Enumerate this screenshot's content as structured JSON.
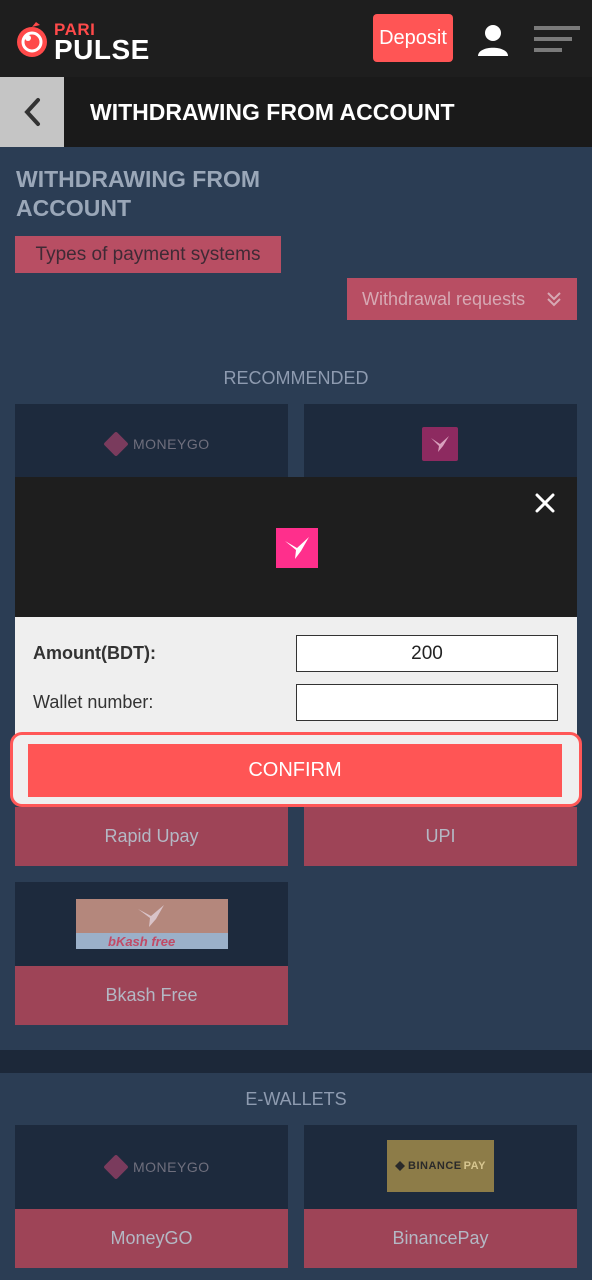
{
  "header": {
    "logo_top": "PARI",
    "logo_bottom": "PULSE",
    "deposit_label": "Deposit"
  },
  "subheader": {
    "title": "WITHDRAWING FROM ACCOUNT"
  },
  "page": {
    "title": "WITHDRAWING FROM ACCOUNT",
    "types_label": "Types of payment systems",
    "requests_label": "Withdrawal requests"
  },
  "recommended": {
    "title": "RECOMMENDED",
    "moneygo_logo_text": "MONEYGO",
    "cards": [
      {
        "label": "Rapid Upay"
      },
      {
        "label": "UPI"
      },
      {
        "label": "Bkash Free",
        "logo_text": "bKash free"
      }
    ]
  },
  "modal": {
    "amount_label": "Amount(BDT):",
    "amount_value": "200",
    "wallet_label": "Wallet number:",
    "wallet_value": "",
    "confirm_label": "CONFIRM"
  },
  "ewallets": {
    "title": "E-WALLETS",
    "cards": [
      {
        "label": "MoneyGO",
        "logo_text": "MONEYGO"
      },
      {
        "label": "BinancePay",
        "logo_text": "BINANCE",
        "logo_text_2": "PAY"
      }
    ]
  },
  "colors": {
    "accent": "#ff5555",
    "card_label_bg": "#9e4457",
    "section_bg": "#2b3d54"
  }
}
